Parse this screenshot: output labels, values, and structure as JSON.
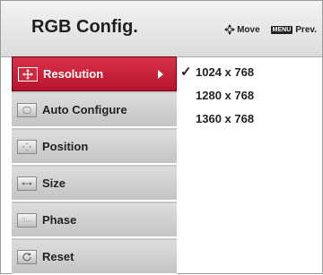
{
  "header": {
    "title": "RGB Config.",
    "move_label": "Move",
    "menu_key": "MENU",
    "prev_label": "Prev."
  },
  "menu": {
    "items": [
      {
        "label": "Resolution",
        "icon": "resolution-icon",
        "active": true
      },
      {
        "label": "Auto Configure",
        "icon": "auto-configure-icon"
      },
      {
        "label": "Position",
        "icon": "position-icon"
      },
      {
        "label": "Size",
        "icon": "size-icon"
      },
      {
        "label": "Phase",
        "icon": "phase-icon"
      },
      {
        "label": "Reset",
        "icon": "reset-icon"
      }
    ]
  },
  "options": {
    "check_mark": "✓",
    "items": [
      {
        "label": "1024 x 768",
        "selected": true
      },
      {
        "label": "1280 x 768"
      },
      {
        "label": "1360 x 768"
      }
    ]
  },
  "colors": {
    "active": "#c41f36",
    "menu_bg": "#c8c8c8"
  }
}
